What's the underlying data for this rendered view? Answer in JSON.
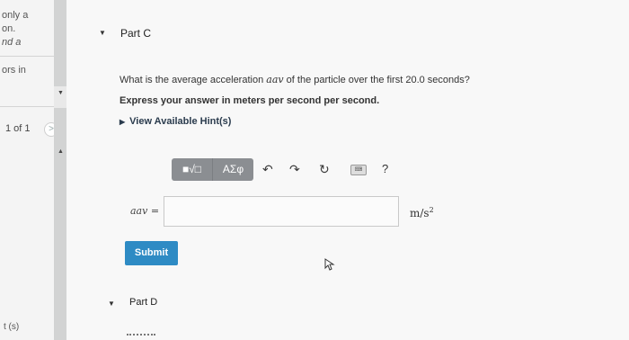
{
  "left_panel": {
    "fragments": [
      "only a",
      "on.",
      "nd a",
      "ors in"
    ],
    "pager": "1 of 1",
    "next_glyph": ">",
    "axis_label": "t (s)"
  },
  "part_c": {
    "title": "Part C",
    "question_pre": "What is the average acceleration ",
    "question_symbol": "aav",
    "question_post": " of the particle over the first 20.0 seconds?",
    "instruction": "Express your answer in meters per second per second.",
    "hints_label": "View Available Hint(s)"
  },
  "toolbar": {
    "templates_label": "■√□",
    "greek_label": "AΣφ",
    "undo_glyph": "↶",
    "redo_glyph": "↷",
    "reset_glyph": "↻",
    "keyboard_label": "⌨",
    "help_glyph": "?"
  },
  "answer": {
    "variable_label": "aav =",
    "value": "",
    "unit_base": "m/s",
    "unit_exp": "2"
  },
  "submit_label": "Submit",
  "part_d": {
    "title": "Part D"
  }
}
